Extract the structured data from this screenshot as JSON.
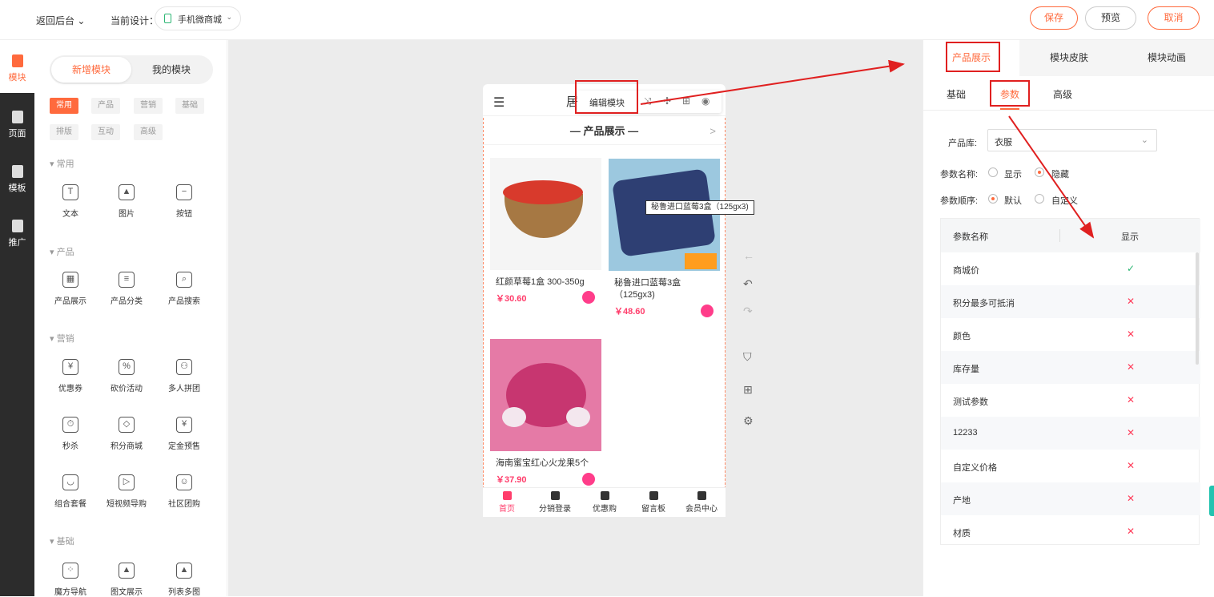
{
  "topbar": {
    "back": "返回后台 ⌄",
    "current_label": "当前设计：",
    "design_name": "手机微商城",
    "save": "保存",
    "preview": "预览",
    "cancel": "取消"
  },
  "sidebar": [
    {
      "label": "模块"
    },
    {
      "label": "页面"
    },
    {
      "label": "模板"
    },
    {
      "label": "推广"
    }
  ],
  "module_panel": {
    "tabs": [
      "新增模块",
      "我的模块"
    ],
    "chips_row1": [
      "常用",
      "产品",
      "营销",
      "基础"
    ],
    "chips_row2": [
      "排版",
      "互动",
      "高级"
    ],
    "sections": {
      "common": "▾ 常用",
      "product": "▾ 产品",
      "marketing": "▾ 营销",
      "basic": "▾ 基础"
    },
    "common_items": [
      "文本",
      "图片",
      "按钮"
    ],
    "product_items": [
      "产品展示",
      "产品分类",
      "产品搜索"
    ],
    "marketing_items": [
      "优惠券",
      "砍价活动",
      "多人拼团",
      "秒杀",
      "积分商城",
      "定金预售",
      "组合套餐",
      "短视频导购",
      "社区团购"
    ],
    "basic_items": [
      "魔方导航",
      "图文展示",
      "列表多图"
    ]
  },
  "phone": {
    "title": "居家",
    "edit_label": "编辑模块",
    "section_title": "— 产品展示 —",
    "more": ">",
    "tooltip": "秘鲁进口蓝莓3盒（125gx3)",
    "products": [
      {
        "name": "红颜草莓1盒 300-350g",
        "price": "￥30.60",
        "color": "#c9372c"
      },
      {
        "name": "秘鲁进口蓝莓3盒（125gx3)",
        "price": "￥48.60",
        "color": "#2e3f73"
      },
      {
        "name": "海南蜜宝红心火龙果5个",
        "price": "￥37.90",
        "color": "#d23f7c"
      }
    ],
    "nav": [
      "首页",
      "分销登录",
      "优惠购",
      "留言板",
      "会员中心"
    ]
  },
  "right_panel": {
    "tabs": [
      "产品展示",
      "模块皮肤",
      "模块动画"
    ],
    "subtabs": [
      "基础",
      "参数",
      "高级"
    ],
    "library_label": "产品库:",
    "library_value": "衣服",
    "param_name_label": "参数名称:",
    "param_name_options": [
      "显示",
      "隐藏"
    ],
    "param_order_label": "参数顺序:",
    "param_order_options": [
      "默认",
      "自定义"
    ],
    "table_header": [
      "参数名称",
      "显示"
    ],
    "rows": [
      {
        "name": "商城价",
        "show": "✓"
      },
      {
        "name": "积分最多可抵消",
        "show": "✕"
      },
      {
        "name": "颜色",
        "show": "✕"
      },
      {
        "name": "库存量",
        "show": "✕"
      },
      {
        "name": "测试参数",
        "show": "✕"
      },
      {
        "name": "12233",
        "show": "✕"
      },
      {
        "name": "自定义价格",
        "show": "✕"
      },
      {
        "name": "产地",
        "show": "✕"
      },
      {
        "name": "材质",
        "show": "✕"
      }
    ]
  },
  "colors": {
    "accent": "#ff6a3d",
    "annotation": "#e02020"
  }
}
